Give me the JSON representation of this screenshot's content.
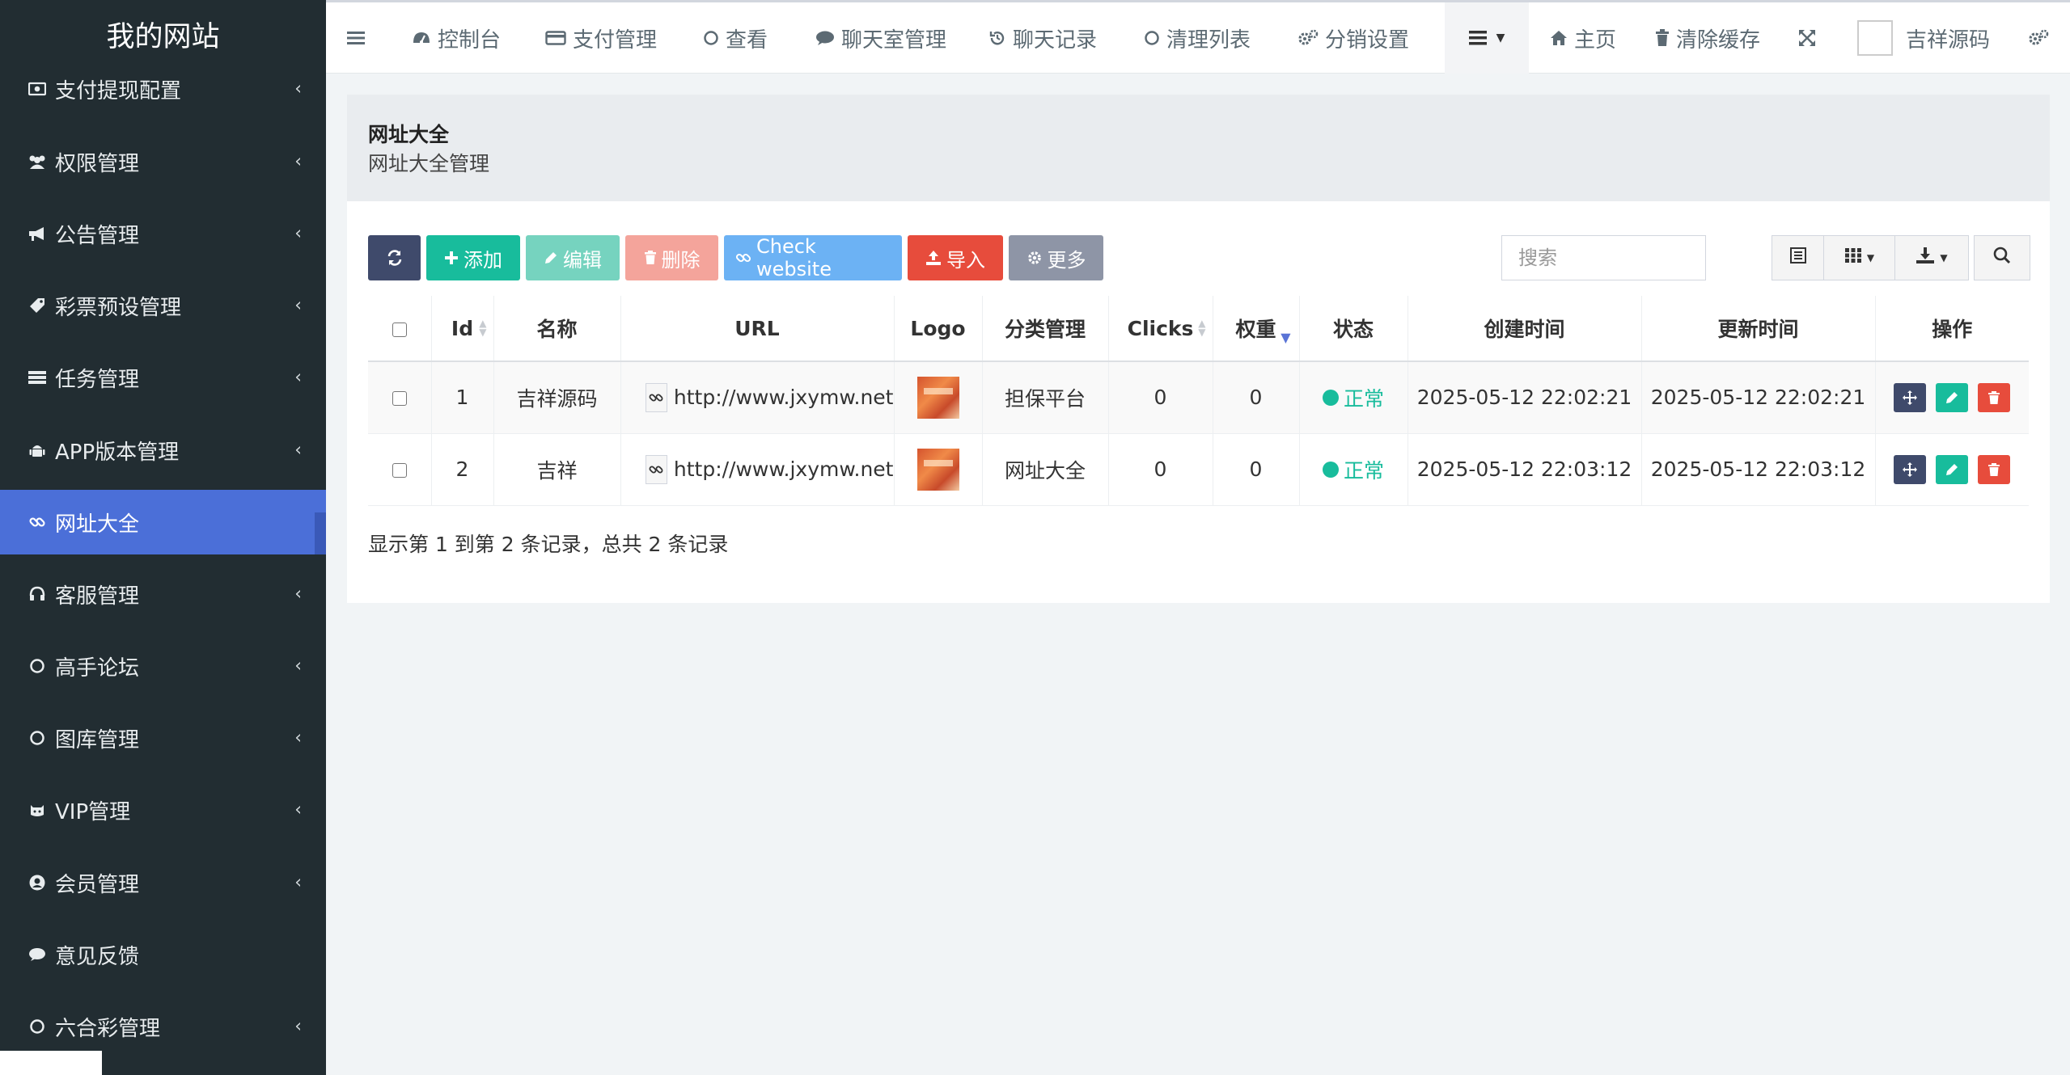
{
  "site": {
    "brand": "我的网站"
  },
  "sidebar": {
    "items": [
      {
        "label": "支付提现配置",
        "icon": "money-icon"
      },
      {
        "label": "权限管理",
        "icon": "users-icon"
      },
      {
        "label": "公告管理",
        "icon": "bullhorn-icon"
      },
      {
        "label": "彩票预设管理",
        "icon": "tag-icon"
      },
      {
        "label": "任务管理",
        "icon": "list-icon"
      },
      {
        "label": "APP版本管理",
        "icon": "android-icon"
      },
      {
        "label": "网址大全",
        "icon": "link-icon"
      },
      {
        "label": "客服管理",
        "icon": "headset-icon"
      },
      {
        "label": "高手论坛",
        "icon": "circle-icon"
      },
      {
        "label": "图库管理",
        "icon": "circle-icon"
      },
      {
        "label": "VIP管理",
        "icon": "github-icon"
      },
      {
        "label": "会员管理",
        "icon": "user-circle-icon"
      },
      {
        "label": "意见反馈",
        "icon": "comment-icon"
      },
      {
        "label": "六合彩管理",
        "icon": "circle-icon"
      }
    ]
  },
  "topnav": {
    "items": [
      {
        "label": "控制台"
      },
      {
        "label": "支付管理"
      },
      {
        "label": "查看"
      },
      {
        "label": "聊天室管理"
      },
      {
        "label": "聊天记录"
      },
      {
        "label": "清理列表"
      },
      {
        "label": "分销设置"
      }
    ],
    "home": "主页",
    "clear_cache": "清除缓存",
    "user": "吉祥源码"
  },
  "header": {
    "title": "网址大全",
    "subtitle": "网址大全管理"
  },
  "toolbar": {
    "add": "添加",
    "edit": "编辑",
    "delete": "删除",
    "check": "Check website",
    "import": "导入",
    "more": "更多",
    "search_placeholder": "搜索"
  },
  "table": {
    "columns": [
      "Id",
      "名称",
      "URL",
      "Logo",
      "分类管理",
      "Clicks",
      "权重",
      "状态",
      "创建时间",
      "更新时间",
      "操作"
    ],
    "rows": [
      {
        "id": "1",
        "name": "吉祥源码",
        "url": "http://www.jxymw.net",
        "category": "担保平台",
        "clicks": "0",
        "weight": "0",
        "status": "正常",
        "created": "2025-05-12 22:02:21",
        "updated": "2025-05-12 22:02:21"
      },
      {
        "id": "2",
        "name": "吉祥",
        "url": "http://www.jxymw.net",
        "category": "网址大全",
        "clicks": "0",
        "weight": "0",
        "status": "正常",
        "created": "2025-05-12 22:03:12",
        "updated": "2025-05-12 22:03:12"
      }
    ]
  },
  "summary": "显示第 1 到第 2 条记录，总共 2 条记录",
  "colors": {
    "sidebar_bg": "#222d32",
    "sidebar_active": "#4b6fd8",
    "add": "#18bc9c",
    "edit": "#76d3bf",
    "delete": "#f4a49b",
    "check": "#6cb2f4",
    "import": "#e74c3c",
    "more": "#8e95a6",
    "refresh": "#3f4a6b",
    "status_ok": "#18bc9c"
  }
}
